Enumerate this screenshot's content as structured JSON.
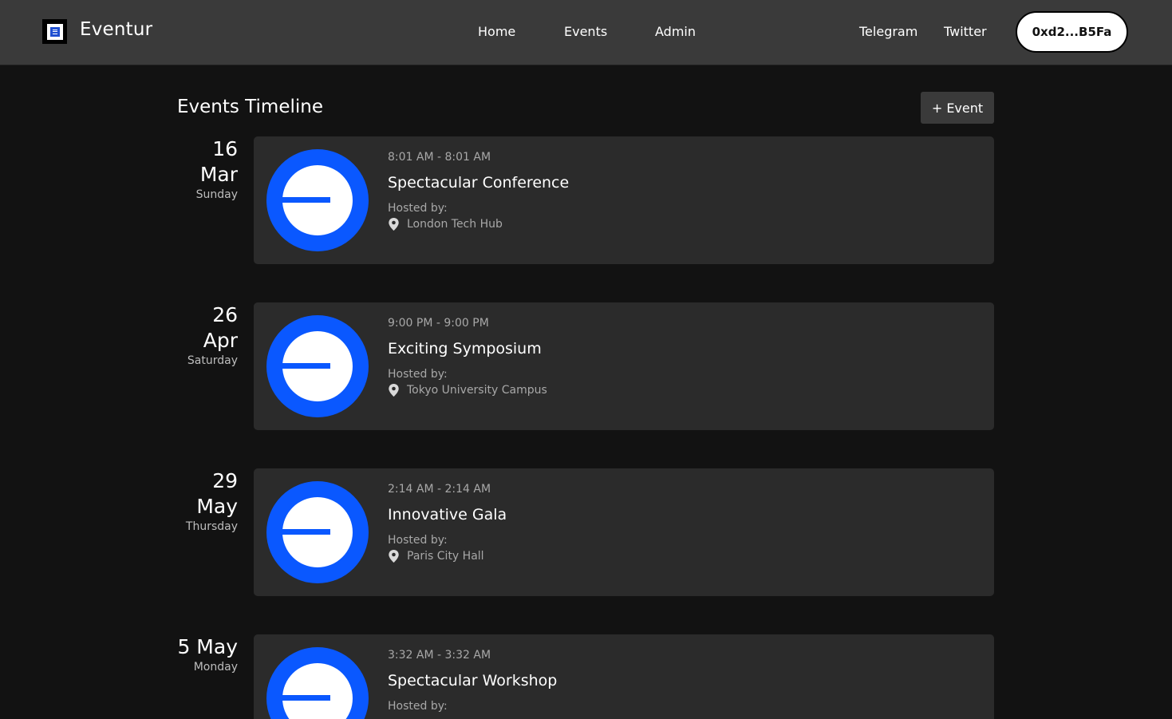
{
  "app": {
    "name": "Eventur"
  },
  "nav": {
    "home": "Home",
    "events": "Events",
    "admin": "Admin"
  },
  "social": {
    "telegram": "Telegram",
    "twitter": "Twitter"
  },
  "wallet": {
    "address": "0xd2...B5Fa"
  },
  "page": {
    "title": "Events Timeline",
    "add_button": "+ Event"
  },
  "colors": {
    "accent": "#0a58ff",
    "topbar": "#3a3a3a",
    "background": "#121212",
    "card": "#2b2b2b"
  },
  "events": [
    {
      "day": "16",
      "month": "Mar",
      "date_line": "",
      "weekday": "Sunday",
      "time": "8:01 AM - 8:01 AM",
      "title": "Spectacular Conference",
      "hosted_label": "Hosted by:",
      "location": "London Tech Hub",
      "location_icon": "map-pin-icon"
    },
    {
      "day": "26",
      "month": "Apr",
      "date_line": "",
      "weekday": "Saturday",
      "time": "9:00 PM - 9:00 PM",
      "title": "Exciting Symposium",
      "hosted_label": "Hosted by:",
      "location": "Tokyo University Campus",
      "location_icon": "map-pin-icon"
    },
    {
      "day": "29",
      "month": "May",
      "date_line": "",
      "weekday": "Thursday",
      "time": "2:14 AM - 2:14 AM",
      "title": "Innovative Gala",
      "hosted_label": "Hosted by:",
      "location": "Paris City Hall",
      "location_icon": "map-pin-icon"
    },
    {
      "day": "",
      "month": "",
      "date_line": "5 May",
      "weekday": "Monday",
      "time": "3:32 AM - 3:32 AM",
      "title": "Spectacular Workshop",
      "hosted_label": "Hosted by:",
      "location": "",
      "location_icon": "map-pin-icon"
    }
  ]
}
